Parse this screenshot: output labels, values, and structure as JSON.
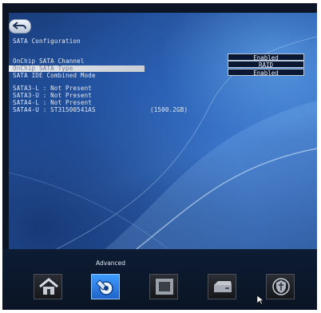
{
  "header": {
    "title": "SATA Configuration"
  },
  "settings": [
    {
      "label": "OnChip SATA Channel",
      "value": "Enabled"
    },
    {
      "label": "OnChip SATA Type",
      "value": "RAID"
    },
    {
      "label": "SATA IDE Combined Mode",
      "value": "Enabled"
    }
  ],
  "ports": [
    {
      "label": "SATA3-L : Not Present",
      "size": ""
    },
    {
      "label": "SATA3-U : Not Present",
      "size": ""
    },
    {
      "label": "SATA4-L : Not Present",
      "size": ""
    },
    {
      "label": "SATA4-U : ST31500541AS",
      "size": "(1500.2GB)"
    }
  ],
  "bottom_nav": {
    "active_label": "Advanced",
    "icons": [
      "home-icon",
      "advanced-icon",
      "chip-icon",
      "storage-icon",
      "shield-icon"
    ]
  }
}
